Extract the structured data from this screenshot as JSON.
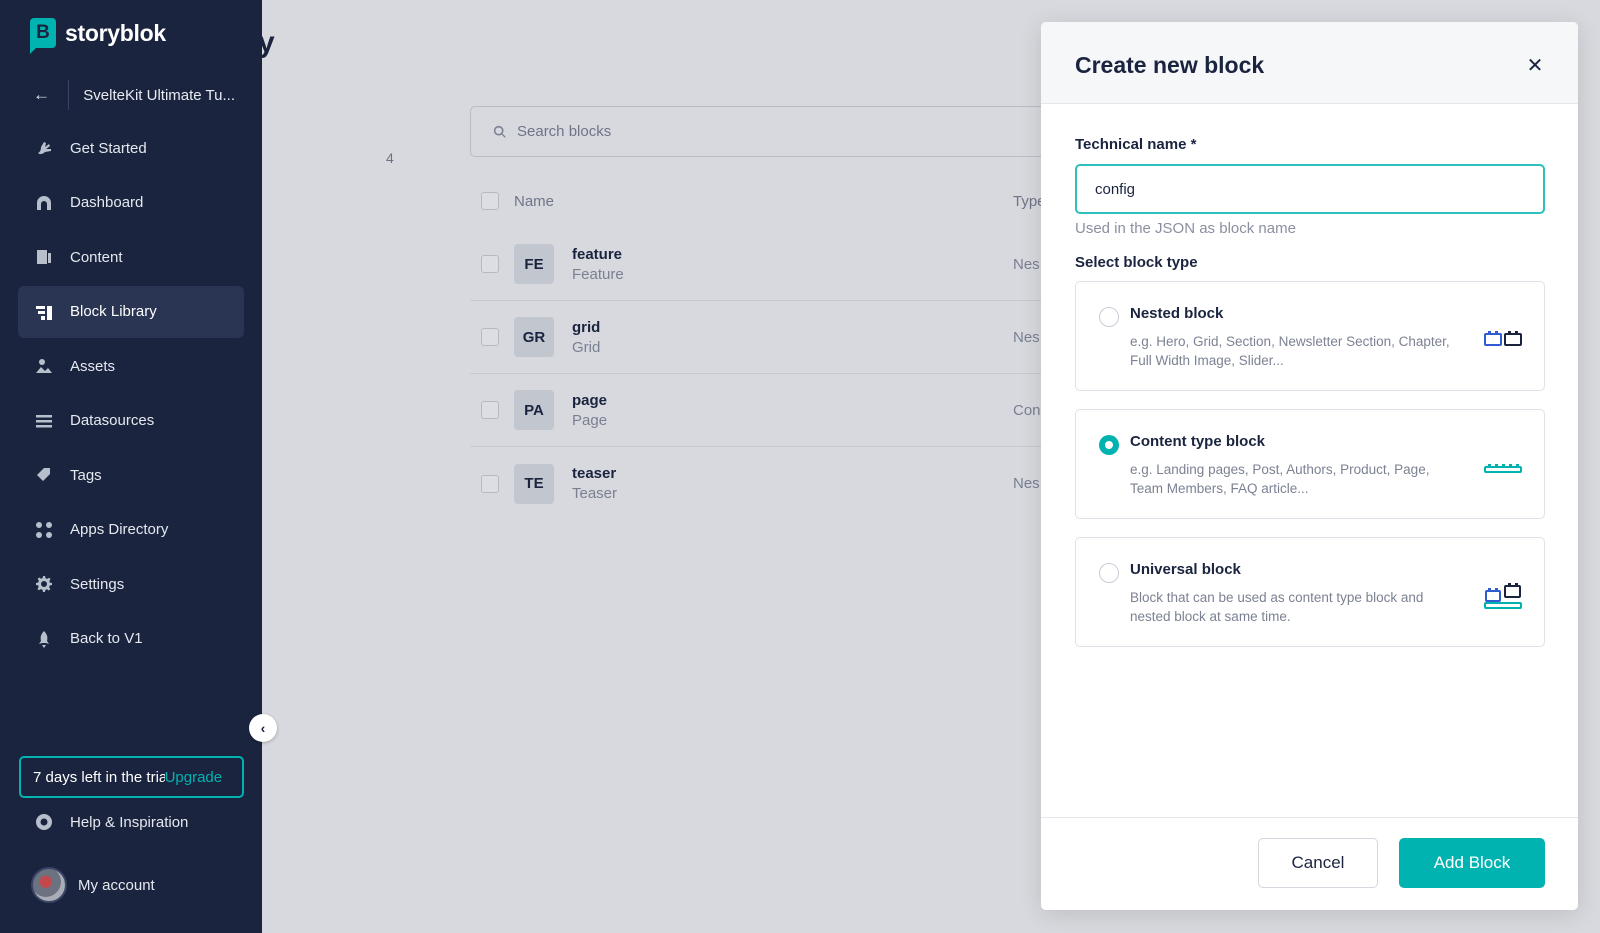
{
  "app": {
    "brand": "storyblok",
    "accent": "#00b3b0",
    "sidebar_bg": "#1b243f"
  },
  "sidebar": {
    "space_name": "SvelteKit Ultimate Tu...",
    "items": [
      {
        "label": "Get Started",
        "icon": "rocket-hand-icon",
        "active": false
      },
      {
        "label": "Dashboard",
        "icon": "dashboard-icon",
        "active": false
      },
      {
        "label": "Content",
        "icon": "content-icon",
        "active": false
      },
      {
        "label": "Block Library",
        "icon": "block-library-icon",
        "active": true
      },
      {
        "label": "Assets",
        "icon": "assets-icon",
        "active": false
      },
      {
        "label": "Datasources",
        "icon": "datasources-icon",
        "active": false
      },
      {
        "label": "Tags",
        "icon": "tag-icon",
        "active": false
      },
      {
        "label": "Apps Directory",
        "icon": "apps-icon",
        "active": false
      },
      {
        "label": "Settings",
        "icon": "gear-icon",
        "active": false
      },
      {
        "label": "Back to V1",
        "icon": "rocket-icon",
        "active": false
      }
    ],
    "trial_text": "7 days left in the trial",
    "trial_upgrade": "Upgrade",
    "help_label": "Help & Inspiration",
    "account_label": "My account"
  },
  "page": {
    "title_fragment": "y",
    "count": "4",
    "search_placeholder": "Search blocks",
    "columns": {
      "name": "Name",
      "type": "Type"
    },
    "rows": [
      {
        "badge": "FE",
        "name": "feature",
        "display": "Feature",
        "type": "Nes"
      },
      {
        "badge": "GR",
        "name": "grid",
        "display": "Grid",
        "type": "Nes"
      },
      {
        "badge": "PA",
        "name": "page",
        "display": "Page",
        "type": "Con"
      },
      {
        "badge": "TE",
        "name": "teaser",
        "display": "Teaser",
        "type": "Nes"
      }
    ]
  },
  "modal": {
    "title": "Create new block",
    "technical_name_label": "Technical name *",
    "technical_name_value": "config",
    "technical_name_hint": "Used in the JSON as block name",
    "block_type_label": "Select block type",
    "options": [
      {
        "title": "Nested block",
        "desc": "e.g. Hero, Grid, Section, Newsletter Section, Chapter, Full Width Image, Slider...",
        "selected": false,
        "icon": "nested-block-icon"
      },
      {
        "title": "Content type block",
        "desc": "e.g. Landing pages, Post, Authors, Product, Page, Team Members, FAQ article...",
        "selected": true,
        "icon": "content-type-block-icon"
      },
      {
        "title": "Universal block",
        "desc": "Block that can be used as content type block and nested block at same time.",
        "selected": false,
        "icon": "universal-block-icon"
      }
    ],
    "cancel_label": "Cancel",
    "add_label": "Add Block"
  }
}
